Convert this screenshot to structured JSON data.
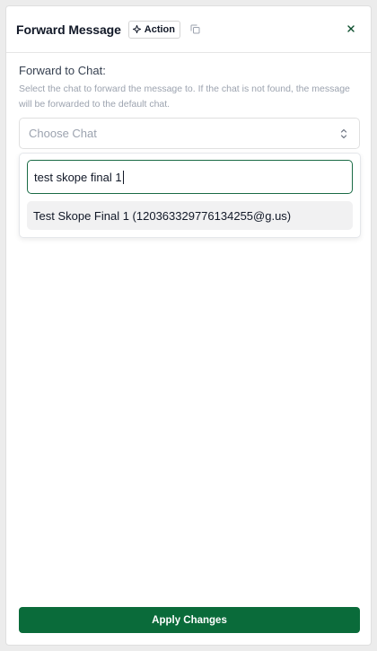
{
  "header": {
    "title": "Forward Message",
    "badge_label": "Action"
  },
  "field": {
    "label": "Forward to Chat:",
    "help": "Select the chat to forward the message to. If the chat is not found, the message will be forwarded to the default chat.",
    "placeholder": "Choose Chat"
  },
  "dropdown": {
    "search_value": "test skope final 1",
    "options": [
      {
        "label": "Test Skope Final 1 (120363329776134255@g.us)"
      }
    ]
  },
  "footer": {
    "apply_label": "Apply Changes"
  },
  "colors": {
    "accent": "#0a6b3a",
    "focus_border": "#1a6b45"
  },
  "icons": [
    "action-icon",
    "copy-icon",
    "close-icon",
    "chevron-updown-icon"
  ]
}
